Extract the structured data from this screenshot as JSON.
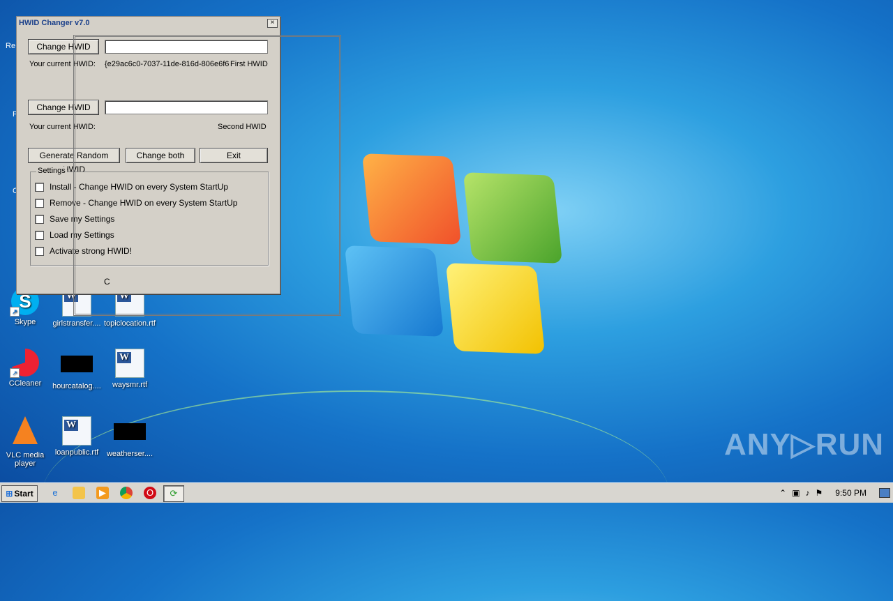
{
  "desktop": {
    "icons": [
      {
        "label": "Skype"
      },
      {
        "label": "girlstransfer...."
      },
      {
        "label": "topiclocation.rtf"
      },
      {
        "label": "CCleaner"
      },
      {
        "label": "hourcatalog...."
      },
      {
        "label": "waysmr.rtf"
      },
      {
        "label": "VLC media player"
      },
      {
        "label": "loanpublic.rtf"
      },
      {
        "label": "weatherser...."
      }
    ],
    "partial_labels": {
      "recycle": "Re",
      "left_f": "F",
      "left_c": "C"
    }
  },
  "window": {
    "title": "HWID Changer v7.0",
    "close_glyph": "×",
    "change_hwid_label": "Change HWID",
    "first_input_value": "",
    "first_current_label": "Your current HWID:",
    "first_current_value": "{e29ac6c0-7037-11de-816d-806e6f6",
    "first_tag": "First HWID",
    "second_input_value": "",
    "second_current_label": "Your current HWID:",
    "second_tag": "Second HWID",
    "generate_label": "Generate Random HWID",
    "change_both_label": "Change both",
    "exit_label": "Exit",
    "settings": {
      "legend": "Settings",
      "options": [
        "Install - Change HWID on every System StartUp",
        "Remove - Change HWID on every System StartUp",
        "Save my Settings",
        "Load my Settings",
        "Activate strong HWID!"
      ]
    },
    "footer_char": "C"
  },
  "taskbar": {
    "start_label": "Start",
    "clock": "9:50 PM"
  },
  "watermark": "ANY▷RUN",
  "colors": {
    "desktop_blue": "#1572c8",
    "window_bg": "#d4d0c8",
    "title_text": "#1a3f8a"
  }
}
